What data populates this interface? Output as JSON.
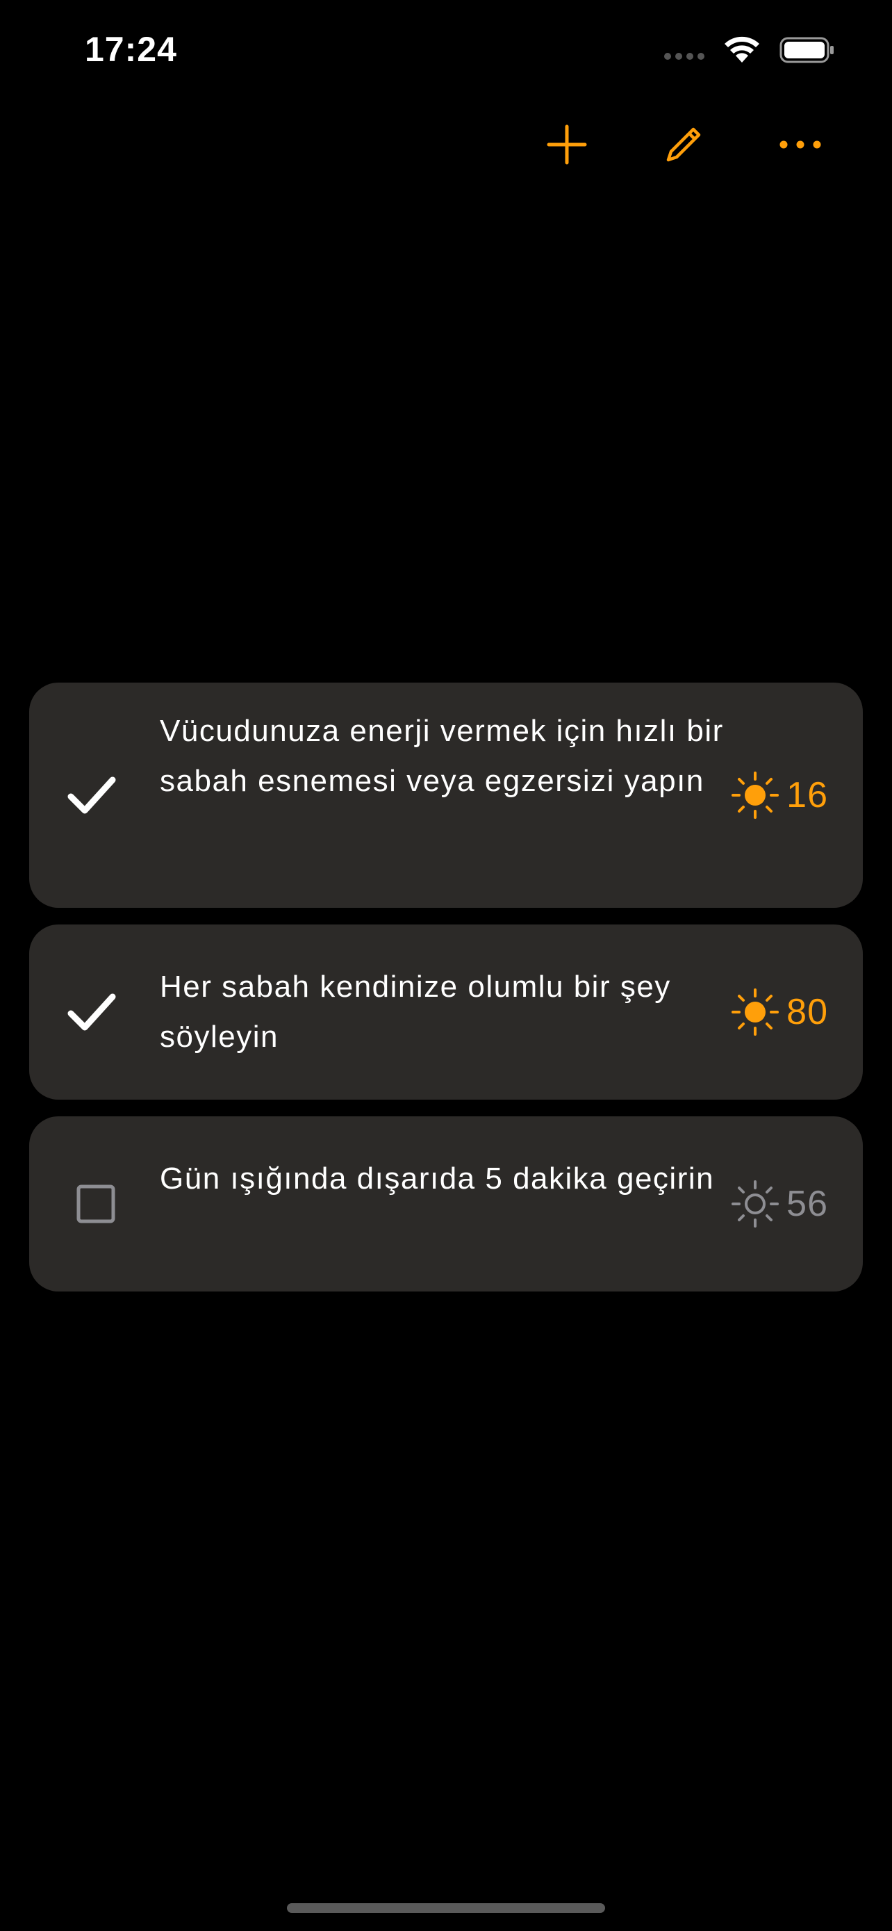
{
  "status_bar": {
    "time": "17:24",
    "icons": [
      "signal-dots-icon",
      "wifi-icon",
      "battery-icon"
    ]
  },
  "toolbar": {
    "accent_color": "#ff9f0a",
    "buttons": [
      {
        "icon": "plus-icon"
      },
      {
        "icon": "pencil-icon"
      },
      {
        "icon": "ellipsis-icon"
      }
    ]
  },
  "tasks": [
    {
      "text": "Vücudunuza enerji vermek için hızlı bir sabah esnemesi veya egzersizi yapın",
      "done": true,
      "score": "16",
      "score_color": "#ff9f0a"
    },
    {
      "text": "Her sabah kendinize olumlu bir şey söyleyin",
      "done": true,
      "score": "80",
      "score_color": "#ff9f0a"
    },
    {
      "text": "Gün ışığında dışarıda 5 dakika geçirin",
      "done": false,
      "score": "56",
      "score_color": "#8e8e93"
    }
  ]
}
